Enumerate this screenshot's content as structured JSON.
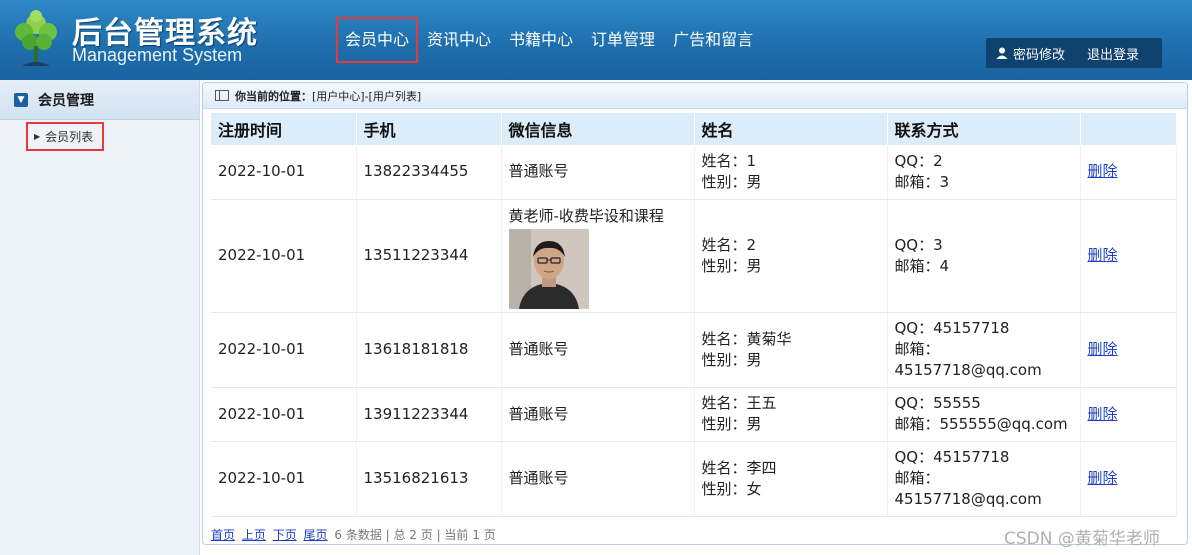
{
  "header": {
    "title": "后台管理系统",
    "subtitle": "Management System",
    "nav": [
      "会员中心",
      "资讯中心",
      "书籍中心",
      "订单管理",
      "广告和留言"
    ],
    "change_password": "密码修改",
    "logout": "退出登录"
  },
  "sidebar": {
    "group": "会员管理",
    "item": "会员列表"
  },
  "breadcrumb": {
    "label": "你当前的位置：",
    "path": "[用户中心]-[用户列表]"
  },
  "table": {
    "columns": [
      "注册时间",
      "手机",
      "微信信息",
      "姓名",
      "联系方式",
      ""
    ],
    "rows": [
      {
        "date": "2022-10-01",
        "phone": "13822334455",
        "wechat": "普通账号",
        "name": "姓名：1",
        "gender": "性别：男",
        "qq": "QQ：2",
        "email": "邮箱：3",
        "action": "删除"
      },
      {
        "date": "2022-10-01",
        "phone": "13511223344",
        "wechat": "黄老师-收费毕设和课程",
        "name": "姓名：2",
        "gender": "性别：男",
        "qq": "QQ：3",
        "email": "邮箱：4",
        "action": "删除"
      },
      {
        "date": "2022-10-01",
        "phone": "13618181818",
        "wechat": "普通账号",
        "name": "姓名：黄菊华",
        "gender": "性别：男",
        "qq": "QQ：45157718",
        "email": "邮箱：45157718@qq.com",
        "action": "删除"
      },
      {
        "date": "2022-10-01",
        "phone": "13911223344",
        "wechat": "普通账号",
        "name": "姓名：王五",
        "gender": "性别：男",
        "qq": "QQ：55555",
        "email": "邮箱：555555@qq.com",
        "action": "删除"
      },
      {
        "date": "2022-10-01",
        "phone": "13516821613",
        "wechat": "普通账号",
        "name": "姓名：李四",
        "gender": "性别：女",
        "qq": "QQ：45157718",
        "email": "邮箱：45157718@qq.com",
        "action": "删除"
      }
    ]
  },
  "pager": {
    "first": "首页",
    "prev": "上页",
    "next": "下页",
    "last": "尾页",
    "summary": "6 条数据 | 总 2 页 | 当前 1 页"
  },
  "watermark": "CSDN @黄菊华老师",
  "colors": {
    "header_blue": "#1f6fae",
    "highlight_red": "#e33b3b",
    "table_header_bg": "#dcedf9",
    "link_blue": "#1b3fc4"
  }
}
